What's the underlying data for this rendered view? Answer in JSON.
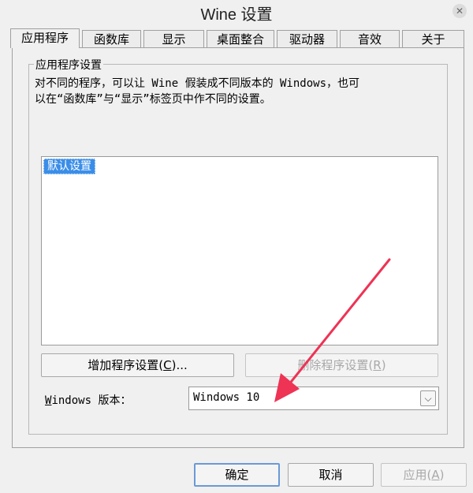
{
  "window": {
    "title": "Wine 设置",
    "close_glyph": "✕"
  },
  "tabs": [
    {
      "label": "应用程序",
      "active": true
    },
    {
      "label": "函数库"
    },
    {
      "label": "显示"
    },
    {
      "label": "桌面整合"
    },
    {
      "label": "驱动器"
    },
    {
      "label": "音效"
    },
    {
      "label": "关于"
    }
  ],
  "applications": {
    "group_title": "应用程序设置",
    "description_line1": "对不同的程序，可以让 Wine 假装成不同版本的 Windows，也可",
    "description_line2": "以在“函数库”与“显示”标签页中作不同的设置。",
    "list_items": [
      "默认设置"
    ],
    "add_button": {
      "pre": "增加程序设置(",
      "key": "C",
      "post": ")..."
    },
    "remove_button": {
      "pre": "删除程序设置(",
      "key": "R",
      "post": ")"
    },
    "version_label": {
      "key": "W",
      "post": "indows 版本："
    },
    "version_value": "Windows 10",
    "combo_arrow_glyph": "⌵"
  },
  "footer": {
    "ok_label": "确定",
    "cancel_label": "取消",
    "apply_button": {
      "pre": "应用(",
      "key": "A",
      "post": ")"
    }
  },
  "annotation": {
    "arrow_color": "#ee3355"
  }
}
